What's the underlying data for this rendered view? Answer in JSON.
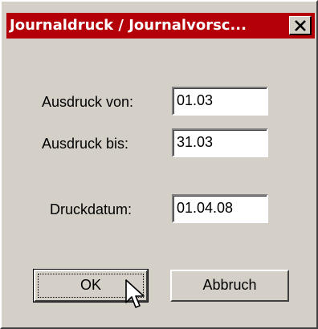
{
  "window": {
    "title": "Journaldruck / Journalvorsc...",
    "close_icon": "close-icon"
  },
  "form": {
    "from_label": "Ausdruck von:",
    "from_value": "01.03",
    "to_label": "Ausdruck bis:",
    "to_value": "31.03",
    "print_date_label": "Druckdatum:",
    "print_date_value": "01.04.08"
  },
  "buttons": {
    "ok_label": "OK",
    "cancel_label": "Abbruch"
  },
  "colors": {
    "titlebar": "#b40008",
    "dialog_face": "#d4d0c8"
  }
}
